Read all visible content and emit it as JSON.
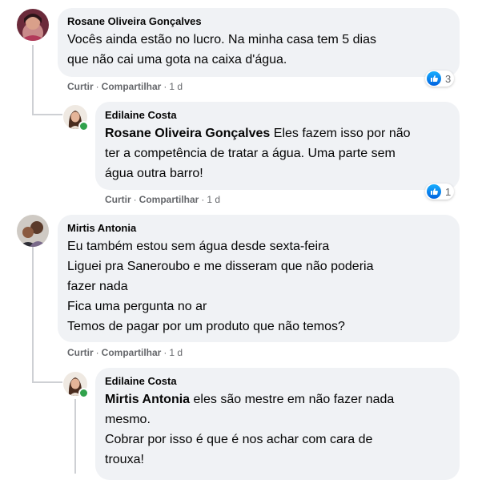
{
  "comments": [
    {
      "author": "Rosane Oliveira Gonçalves",
      "lines": [
        "Vocês ainda estão no lucro. Na minha casa tem 5 dias",
        "que não cai uma gota na caixa d'água."
      ],
      "actions": {
        "like": "Curtir",
        "share": "Compartilhar",
        "time": "1 d"
      },
      "reactions": {
        "icon": "like-icon",
        "count": "3"
      }
    },
    {
      "author": "Edilaine Costa",
      "mention": "Rosane Oliveira Gonçalves",
      "lines": [
        " Eles fazem isso por não",
        "ter a competência de tratar a água. Uma parte sem",
        "água outra barro!"
      ],
      "actions": {
        "like": "Curtir",
        "share": "Compartilhar",
        "time": "1 d"
      },
      "reactions": {
        "icon": "like-icon",
        "count": "1"
      }
    },
    {
      "author": "Mirtis Antonia",
      "lines": [
        "Eu também estou sem água desde sexta-feira",
        "Liguei pra Saneroubo e me disseram que não poderia",
        "fazer nada",
        "Fica uma pergunta no ar",
        "Temos de pagar por um produto que não temos?"
      ],
      "actions": {
        "like": "Curtir",
        "share": "Compartilhar",
        "time": "1 d"
      }
    },
    {
      "author": "Edilaine Costa",
      "mention": "Mirtis Antonia",
      "lines": [
        " eles são mestre em não fazer nada",
        "mesmo.",
        "Cobrar por isso é que é nos achar com cara de",
        "trouxa!"
      ]
    }
  ],
  "colors": {
    "bubble": "#f0f2f5",
    "meta": "#65676b",
    "like_blue": "#0062df",
    "online": "#31a24c"
  }
}
